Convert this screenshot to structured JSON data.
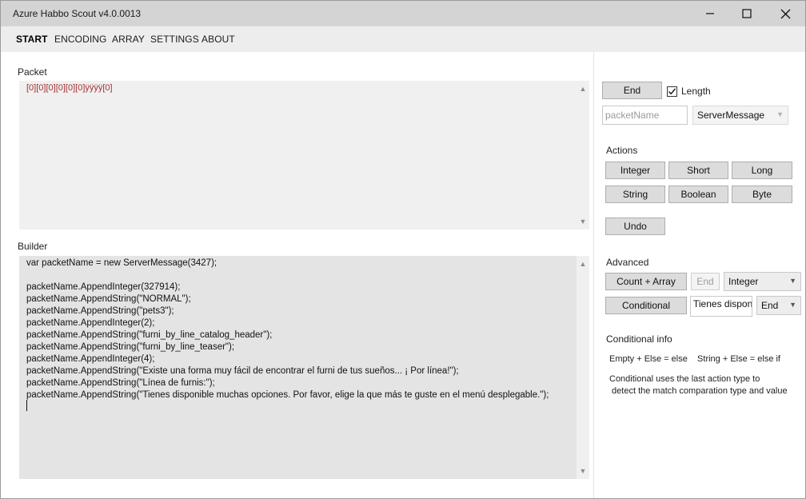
{
  "window": {
    "title": "Azure Habbo Scout v4.0.0013"
  },
  "menu": {
    "items": [
      "START",
      "ENCODING",
      "ARRAY",
      "SETTINGS",
      "ABOUT"
    ],
    "active": "START"
  },
  "packet": {
    "label": "Packet",
    "value": "[0][0][0][0][0][0]ÿÿÿÿ[0]"
  },
  "builder": {
    "label": "Builder",
    "code": "var packetName = new ServerMessage(3427);\n\npacketName.AppendInteger(327914);\npacketName.AppendString(\"NORMAL\");\npacketName.AppendString(\"pets3\");\npacketName.AppendInteger(2);\npacketName.AppendString(\"furni_by_line_catalog_header\");\npacketName.AppendString(\"furni_by_line_teaser\");\npacketName.AppendInteger(4);\npacketName.AppendString(\"Existe una forma muy fácil de encontrar el furni de tus sueños... ¡ Por línea!\");\npacketName.AppendString(\"Línea de furnis:\");\npacketName.AppendString(\"Tienes disponible muchas opciones. Por favor, elige la que más te guste en el menú desplegable.\");"
  },
  "sidebar": {
    "end_label": "End",
    "length_label": "Length",
    "length_checked": true,
    "packet_name_placeholder": "packetName",
    "message_type": "ServerMessage",
    "actions_heading": "Actions",
    "actions": [
      "Integer",
      "Short",
      "Long",
      "String",
      "Boolean",
      "Byte"
    ],
    "undo_label": "Undo",
    "advanced_heading": "Advanced",
    "count_array_label": "Count + Array",
    "adv_end_label": "End",
    "adv_type": "Integer",
    "conditional_label": "Conditional",
    "conditional_value": "Tienes disponible",
    "conditional_end": "End",
    "info_heading": "Conditional info",
    "info_line1": "Empty + Else = else    String + Else = else if",
    "info_line2": "Conditional uses the last action type to",
    "info_line3": " detect the match comparation type and value"
  },
  "icons": [
    "minimize-icon",
    "maximize-icon",
    "close-icon",
    "chevron-up-icon",
    "chevron-down-icon",
    "checkmark-icon"
  ]
}
